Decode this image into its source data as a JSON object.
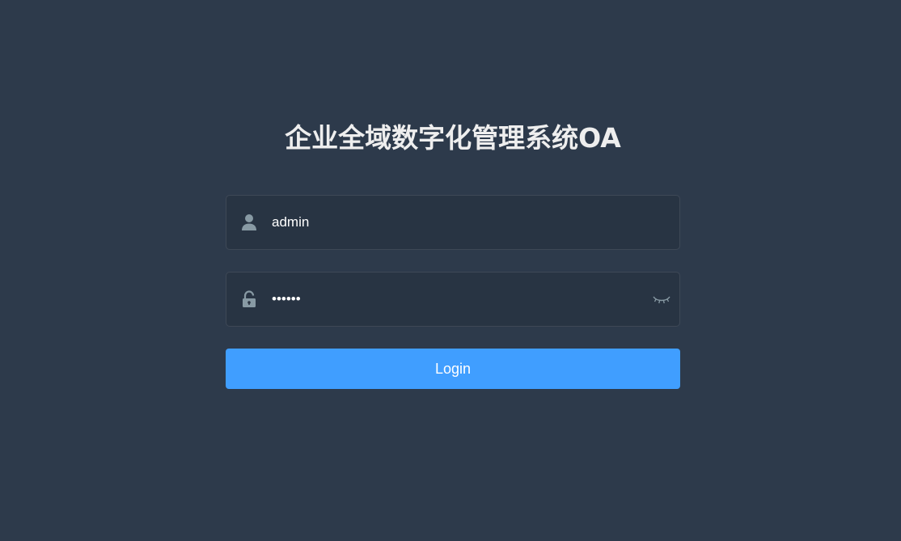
{
  "login": {
    "title": "企业全域数字化管理系统OA",
    "username": {
      "value": "admin",
      "icon": "user-icon"
    },
    "password": {
      "value": "••••••",
      "icon": "lock-icon",
      "toggle_icon": "eye-closed-icon"
    },
    "button_label": "Login"
  },
  "colors": {
    "background": "#2d3a4b",
    "title": "#eeeeee",
    "icon": "#889aa4",
    "button": "#409eff",
    "text": "#ffffff"
  }
}
